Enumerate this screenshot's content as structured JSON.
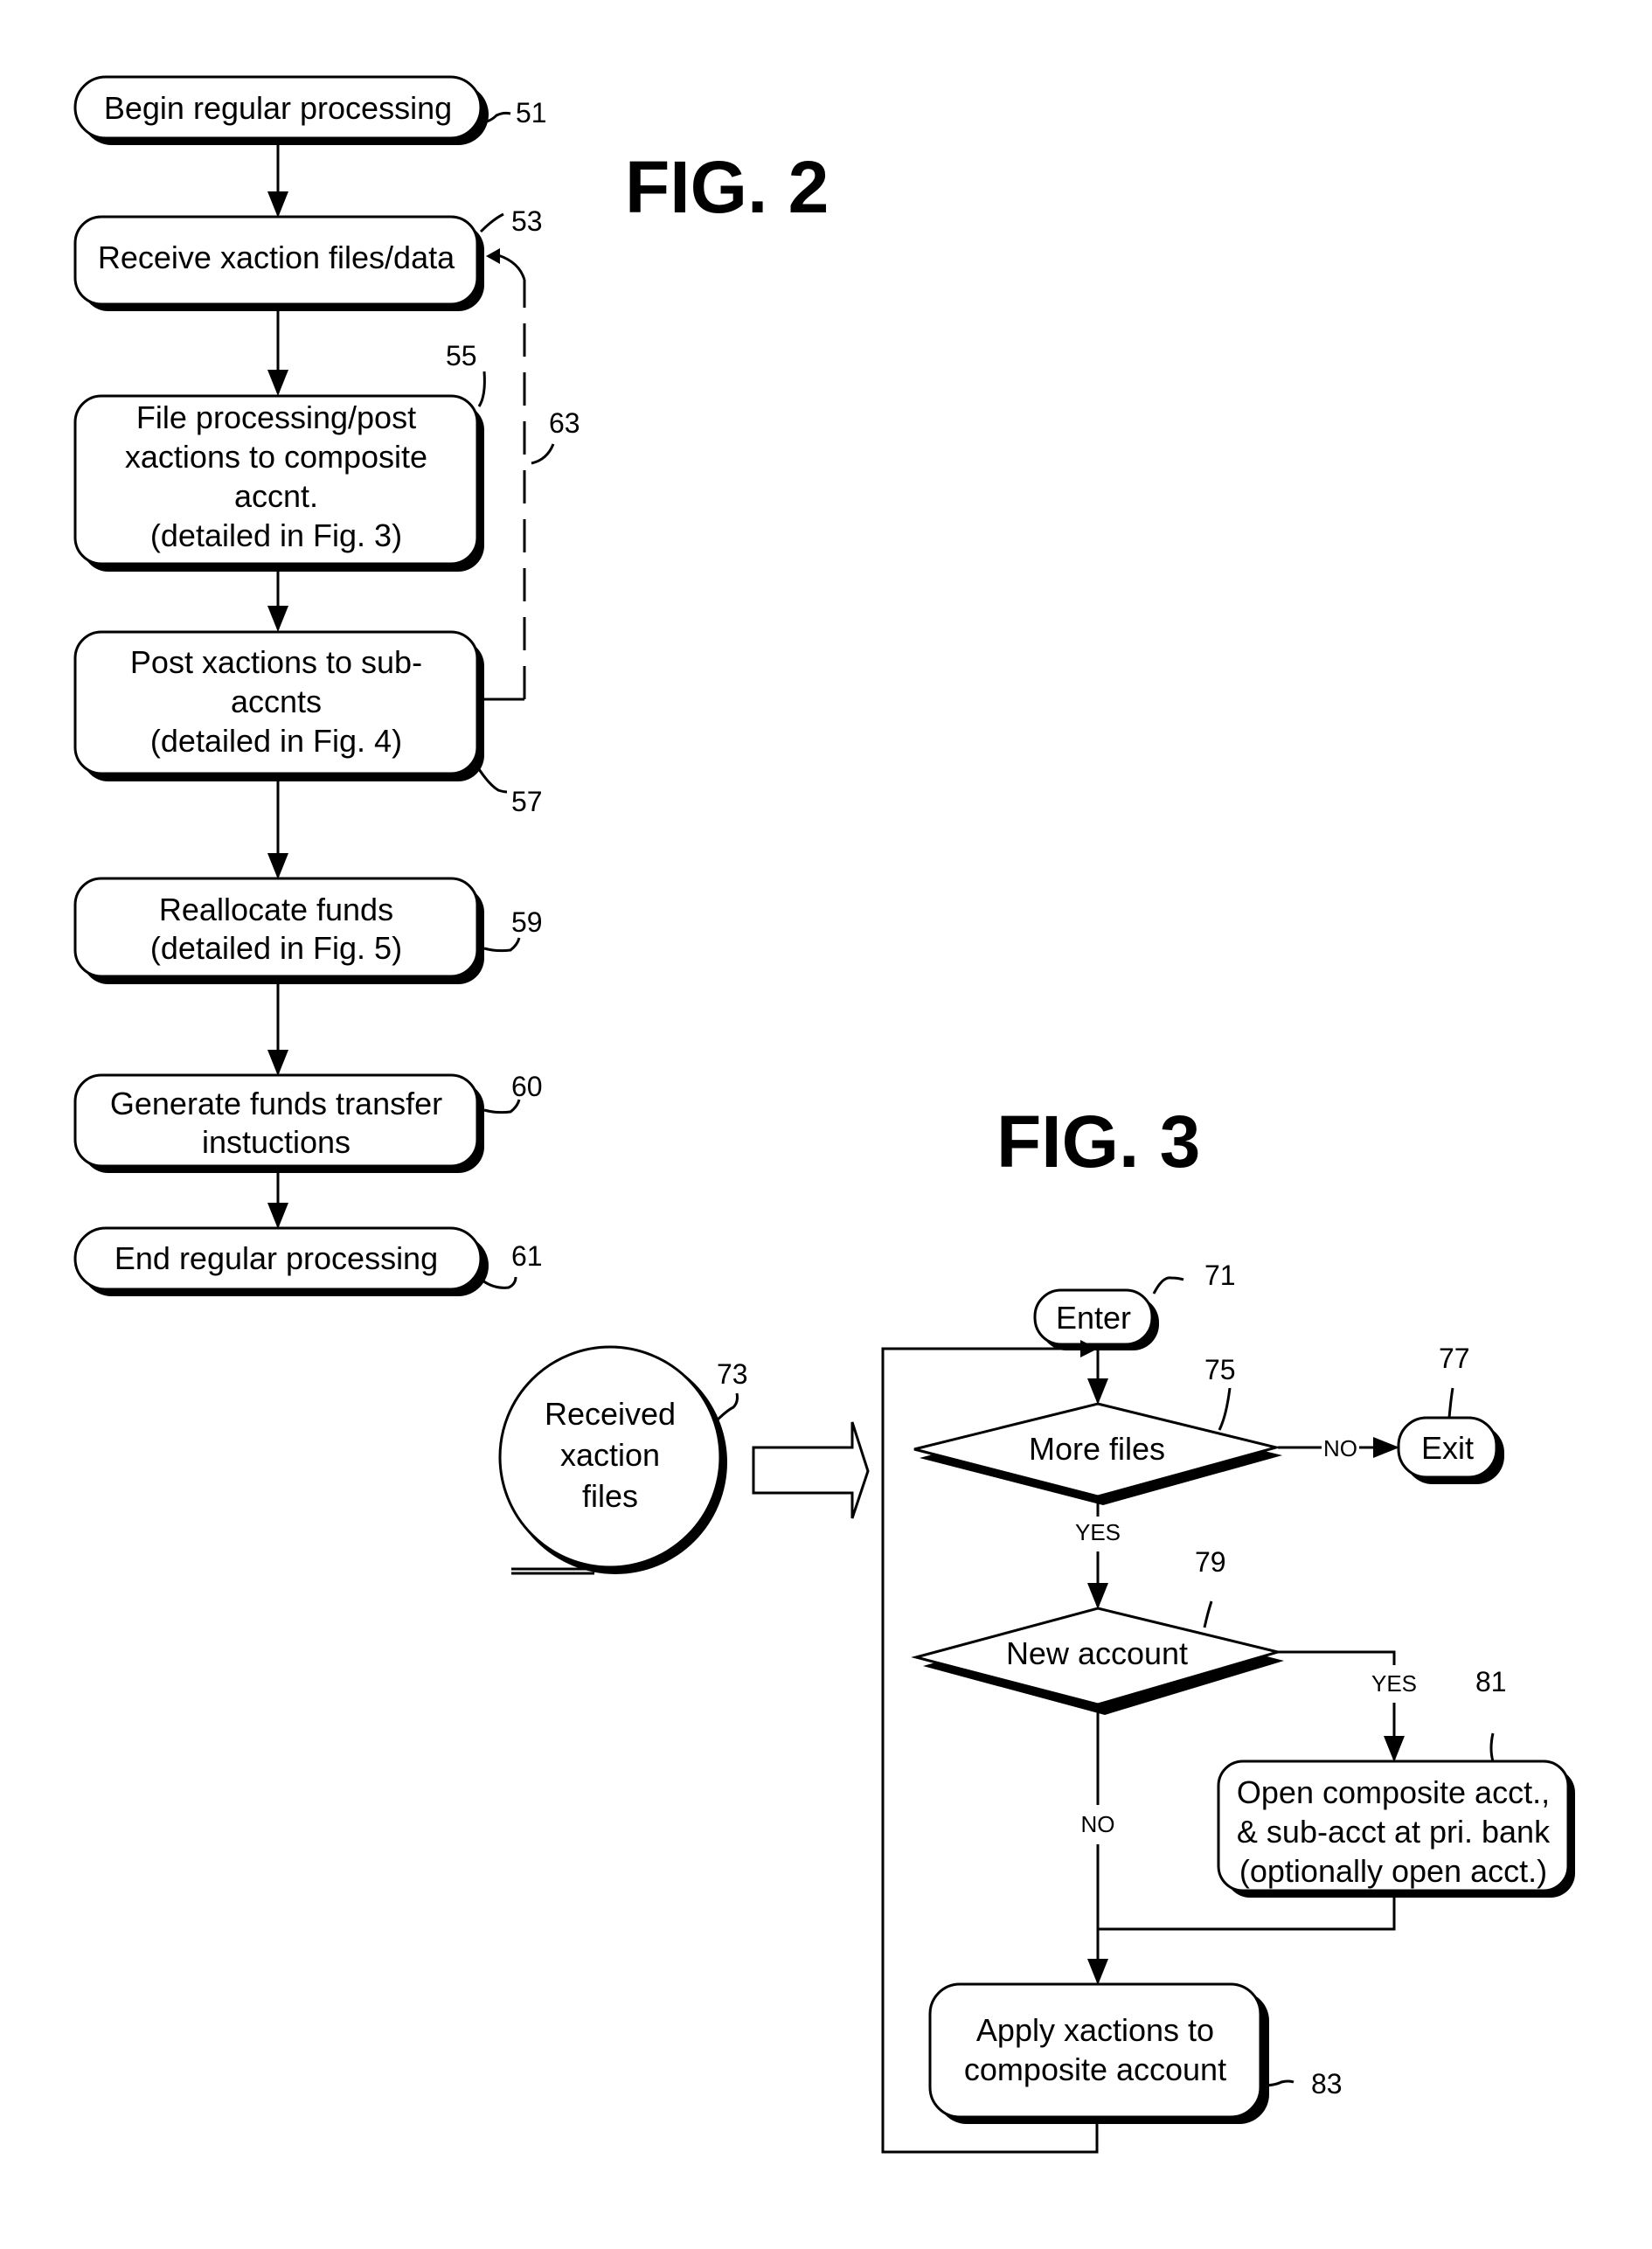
{
  "fig2": {
    "title": "FIG. 2",
    "nodes": [
      {
        "id": "51",
        "ref": "51",
        "shape": "pill",
        "lines": [
          "Begin regular processing"
        ]
      },
      {
        "id": "53",
        "ref": "53",
        "shape": "rounded",
        "lines": [
          "Receive xaction files/data"
        ]
      },
      {
        "id": "55",
        "ref": "55",
        "shape": "rounded",
        "lines": [
          "File processing/post",
          "xactions to composite",
          "accnt.",
          "(detailed in Fig. 3)"
        ]
      },
      {
        "id": "57",
        "ref": "57",
        "shape": "rounded",
        "lines": [
          "Post xactions to sub-",
          "accnts",
          "(detailed in Fig. 4)"
        ]
      },
      {
        "id": "59",
        "ref": "59",
        "shape": "rounded",
        "lines": [
          "Reallocate funds",
          "(detailed in Fig. 5)"
        ]
      },
      {
        "id": "60",
        "ref": "60",
        "shape": "rounded",
        "lines": [
          "Generate funds transfer",
          "instuctions"
        ]
      },
      {
        "id": "61",
        "ref": "61",
        "shape": "pill",
        "lines": [
          "End regular processing"
        ]
      }
    ],
    "feedback_loop_ref": "63"
  },
  "fig3": {
    "title": "FIG. 3",
    "nodes": {
      "enter": {
        "ref": "71",
        "lines": [
          "Enter"
        ]
      },
      "received": {
        "ref": "73",
        "lines": [
          "Received",
          "xaction",
          "files"
        ]
      },
      "more_files": {
        "ref": "75",
        "lines": [
          "More files"
        ]
      },
      "exit": {
        "ref": "77",
        "lines": [
          "Exit"
        ]
      },
      "new_account": {
        "ref": "79",
        "lines": [
          "New account"
        ]
      },
      "open_account": {
        "ref": "81",
        "lines": [
          "Open composite acct.,",
          "& sub-acct at pri. bank",
          "(optionally open acct.)"
        ]
      },
      "apply": {
        "ref": "83",
        "lines": [
          "Apply xactions to",
          "composite account"
        ]
      }
    },
    "edge_labels": {
      "more_files_no": "NO",
      "more_files_yes": "YES",
      "new_account_yes": "YES",
      "new_account_no": "NO"
    }
  }
}
